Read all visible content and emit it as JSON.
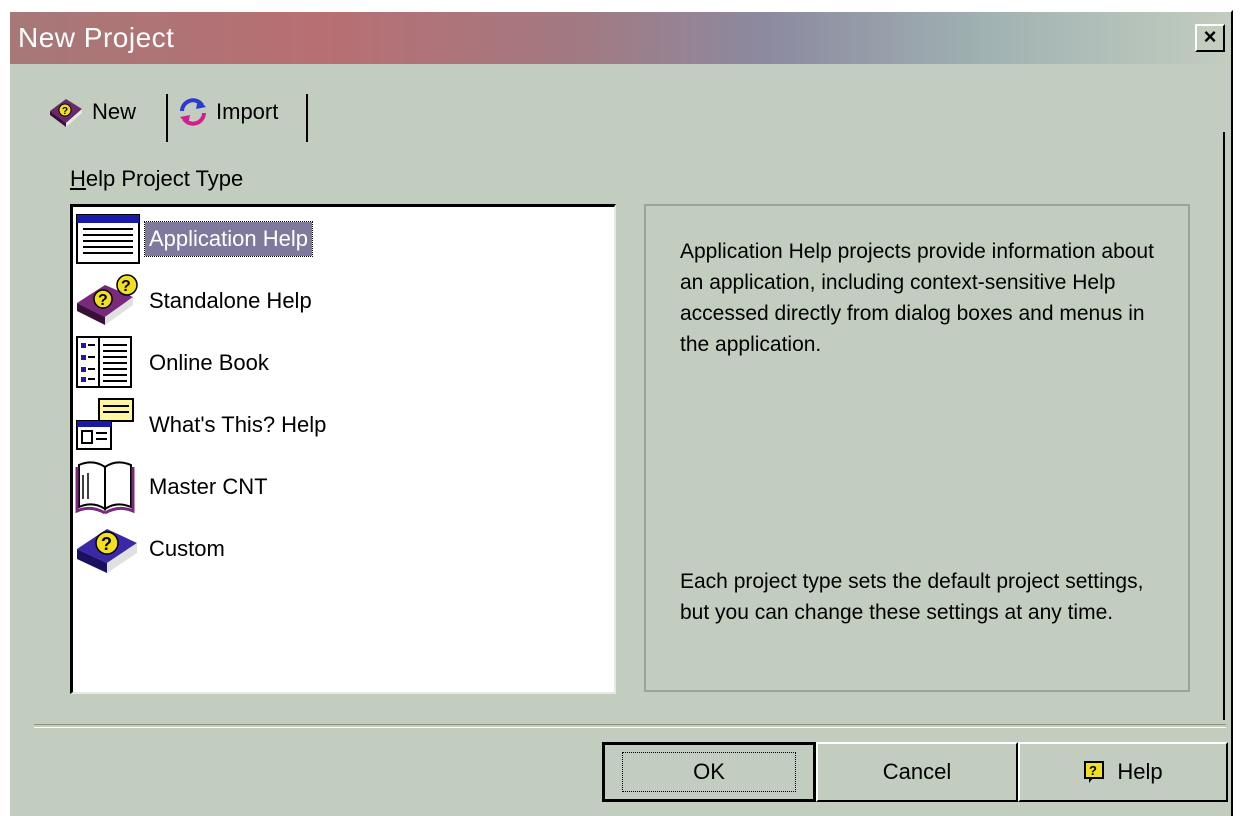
{
  "window": {
    "title": "New Project",
    "close_symbol": "×"
  },
  "tabs": [
    {
      "label": "New",
      "icon": "book-question-icon",
      "selected": true
    },
    {
      "label": "Import",
      "icon": "refresh-arrows-icon",
      "selected": false
    }
  ],
  "group": {
    "label_accel": "H",
    "label_rest": "elp Project Type"
  },
  "project_types": [
    {
      "label": "Application Help",
      "icon": "application-window-icon",
      "selected": true
    },
    {
      "label": "Standalone Help",
      "icon": "help-book-question-icon",
      "selected": false
    },
    {
      "label": "Online Book",
      "icon": "online-book-icon",
      "selected": false
    },
    {
      "label": "What's This? Help",
      "icon": "whats-this-balloon-icon",
      "selected": false
    },
    {
      "label": "Master CNT",
      "icon": "open-book-icon",
      "selected": false
    },
    {
      "label": "Custom",
      "icon": "custom-question-book-icon",
      "selected": false
    }
  ],
  "description": {
    "primary": "Application Help projects provide information about an application, including context-sensitive Help accessed directly from dialog boxes and menus in the application.",
    "secondary": "Each project type sets the default project settings, but you can change these settings at any time."
  },
  "buttons": {
    "ok": "OK",
    "cancel": "Cancel",
    "help": "Help"
  },
  "colors": {
    "selection": "#7f799e",
    "dialog_face": "#c2cdbf",
    "title_gradient_start": "#a67878"
  }
}
